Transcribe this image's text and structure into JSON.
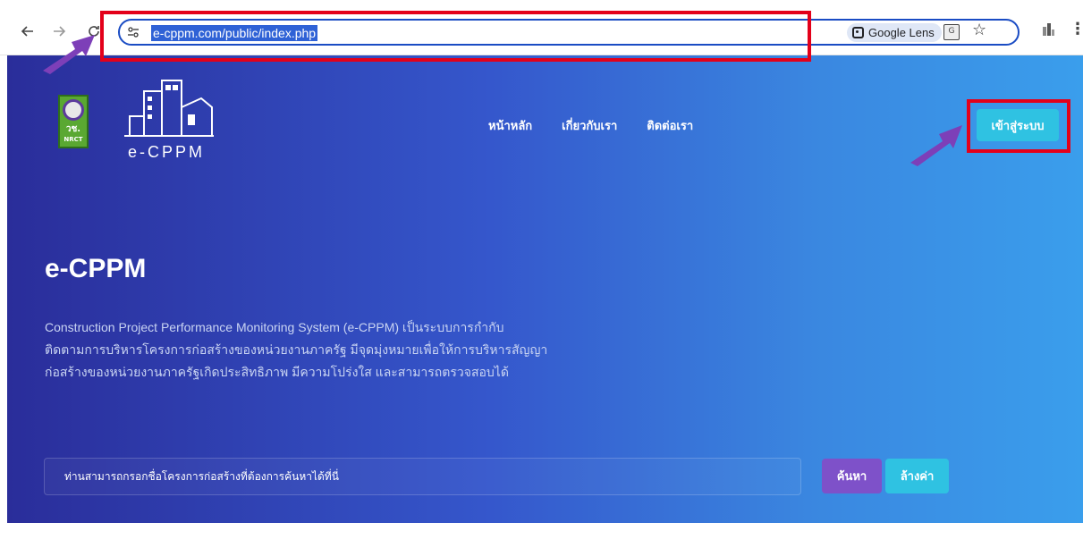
{
  "browser": {
    "url": "e-cppm.com/public/index.php",
    "lens_label": "Google Lens",
    "back_icon": "arrow-left-icon",
    "forward_icon": "arrow-right-icon",
    "reload_icon": "reload-icon",
    "site_info_icon": "tune-icon",
    "translate_icon": "translate-icon",
    "bookmark_icon": "star-icon",
    "menu_icon": "kebab-menu-icon"
  },
  "header": {
    "logo_seal_thai": "วช.",
    "logo_seal_en": "NRCT",
    "logo_text": "e-CPPM",
    "nav": [
      {
        "label": "หน้าหลัก"
      },
      {
        "label": "เกี่ยวกับเรา"
      },
      {
        "label": "ติดต่อเรา"
      }
    ],
    "login_label": "เข้าสู่ระบบ"
  },
  "hero": {
    "title": "e-CPPM",
    "description_lines": [
      "Construction Project Performance Monitoring System (e-CPPM)  เป็นระบบการกำกับ",
      "ติดตามการบริหารโครงการก่อสร้างของหน่วยงานภาครัฐ มีจุดมุ่งหมายเพื่อให้การบริหารสัญญา",
      "ก่อสร้างของหน่วยงานภาครัฐเกิดประสิทธิภาพ มีความโปร่งใส และสามารถตรวจสอบได้"
    ]
  },
  "search": {
    "placeholder": "ท่านสามารถกรอกชื่อโครงการก่อสร้างที่ต้องการค้นหาได้ที่นี่",
    "value": "",
    "search_label": "ค้นหา",
    "clear_label": "ล้างค่า"
  },
  "colors": {
    "highlight": "#e3001a",
    "arrow": "#7d3fb8",
    "login_button": "#2fc2e2",
    "search_button": "#7e51c9"
  }
}
